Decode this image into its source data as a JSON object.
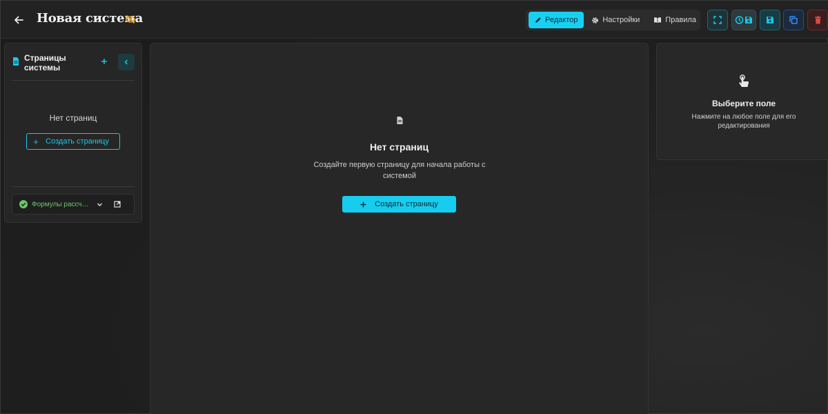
{
  "header": {
    "title": "Новая система",
    "visibility_icon": "eye-off-icon",
    "tabs": [
      {
        "label": "Редактор",
        "icon": "pencil-icon",
        "active": true
      },
      {
        "label": "Настройки",
        "icon": "gear-icon",
        "active": false
      },
      {
        "label": "Правила",
        "icon": "book-icon",
        "active": false
      }
    ],
    "actions": [
      {
        "name": "fullscreen",
        "icon": "expand-icon"
      },
      {
        "name": "autosave-history",
        "icon": "clock-save-icon"
      },
      {
        "name": "save",
        "icon": "floppy-icon"
      },
      {
        "name": "copy",
        "icon": "copy-icon"
      },
      {
        "name": "delete",
        "icon": "trash-icon"
      }
    ]
  },
  "sidebar": {
    "title": "Страницы системы",
    "empty_text": "Нет страниц",
    "create_label": "Создать страницу",
    "formula": {
      "label": "Формулы рассчета",
      "status": "success"
    }
  },
  "canvas": {
    "title": "Нет страниц",
    "description": "Создайте первую страницу для начала работы с системой",
    "create_label": "Создать страницу"
  },
  "properties": {
    "title": "Выберите поле",
    "description": "Нажмите на любое поле для его редактирования"
  },
  "colors": {
    "accent": "#16cdef",
    "success": "#6fc56c",
    "danger": "#e04848",
    "warning": "#e0a020"
  }
}
